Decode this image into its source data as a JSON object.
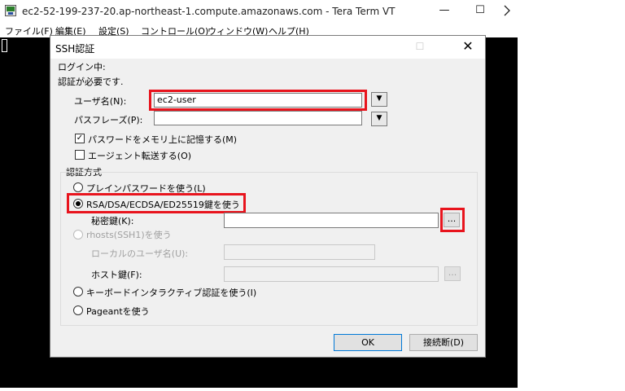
{
  "terminal": {
    "title": "ec2-52-199-237-20.ap-northeast-1.compute.amazonaws.com - Tera Term VT",
    "menu": [
      "ファイル(F)",
      "編集(E)",
      "設定(S)",
      "コントロール(O)",
      "ウィンドウ(W)",
      "ヘルプ(H)"
    ],
    "controls": {
      "minimize": "—",
      "maximize": "☐",
      "close": "✕"
    }
  },
  "dialog": {
    "title": "SSH認証",
    "status_line1": "ログイン中:",
    "status_line2": "認証が必要です.",
    "username_label": "ユーザ名(N):",
    "username_value": "ec2-user",
    "passphrase_label": "パスフレーズ(P):",
    "passphrase_value": "",
    "remember_password": {
      "label": "パスワードをメモリ上に記憶する(M)",
      "checked": true
    },
    "agent_forwarding": {
      "label": "エージェント転送する(O)",
      "checked": false
    },
    "auth_group_title": "認証方式",
    "methods": {
      "plain": "プレインパスワードを使う(L)",
      "rsa": "RSA/DSA/ECDSA/ED25519鍵を使う",
      "private_key_label": "秘密鍵(K):",
      "browse": "...",
      "rhosts": "rhosts(SSH1)を使う",
      "local_user_label": "ローカルのユーザ名(U):",
      "host_key_label": "ホスト鍵(F):",
      "keyboard_interactive": "キーボードインタラクティブ認証を使う(I)",
      "pageant": "Pageantを使う"
    },
    "selected_method": "rsa",
    "ok": "OK",
    "disconnect": "接続断(D)"
  },
  "colors": {
    "highlight": "#e8141d",
    "terminal_bg": "#000000",
    "dialog_bg": "#f0f0f0"
  }
}
